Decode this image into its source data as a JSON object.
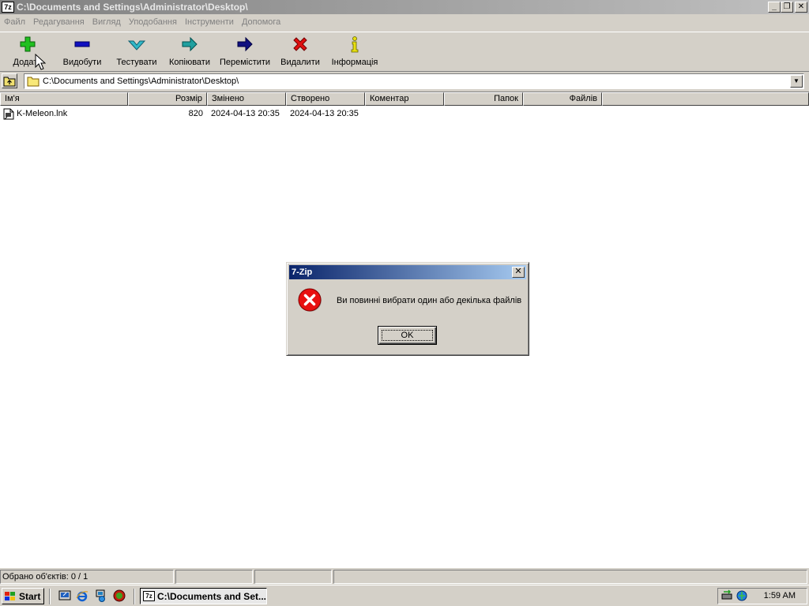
{
  "window": {
    "app_icon_text": "7z",
    "title": "C:\\Documents and Settings\\Administrator\\Desktop\\",
    "caption_minimize": "_",
    "caption_restore": "❐",
    "caption_close": "✕"
  },
  "menu": [
    "Файл",
    "Редагування",
    "Вигляд",
    "Уподобання",
    "Інструменти",
    "Допомога"
  ],
  "toolbar": {
    "add": "Додати",
    "extract": "Видобути",
    "test": "Тестувати",
    "copy": "Копіювати",
    "move": "Перемістити",
    "delete": "Видалити",
    "info": "Інформація"
  },
  "address": {
    "path": "C:\\Documents and Settings\\Administrator\\Desktop\\",
    "dropdown_glyph": "▼"
  },
  "columns": {
    "name": "Ім'я",
    "size": "Розмір",
    "modified": "Змінено",
    "created": "Створено",
    "comment": "Коментар",
    "folders": "Папок",
    "files": "Файлів"
  },
  "files": [
    {
      "name": "K-Meleon.lnk",
      "size": "820",
      "modified": "2024-04-13 20:35",
      "created": "2024-04-13 20:35",
      "comment": "",
      "folders": "",
      "files": ""
    }
  ],
  "status": {
    "selected": "Обрано об'єктів: 0 / 1",
    "pane2": "",
    "pane3": "",
    "pane4": ""
  },
  "dialog": {
    "title": "7-Zip",
    "close_glyph": "✕",
    "icon": "error-icon",
    "message": "Ви повинні вибрати один або декілька файлів",
    "ok": "OK"
  },
  "taskbar": {
    "start": "Start",
    "task_icon_text": "7z",
    "task_title": "C:\\Documents and Set...",
    "clock": "1:59 AM"
  },
  "colors": {
    "dialog_title_start": "#0a246a",
    "dialog_title_end": "#a6caf0",
    "error_red": "#e81010",
    "add_green": "#20c020",
    "extract_blue": "#1010c0"
  }
}
